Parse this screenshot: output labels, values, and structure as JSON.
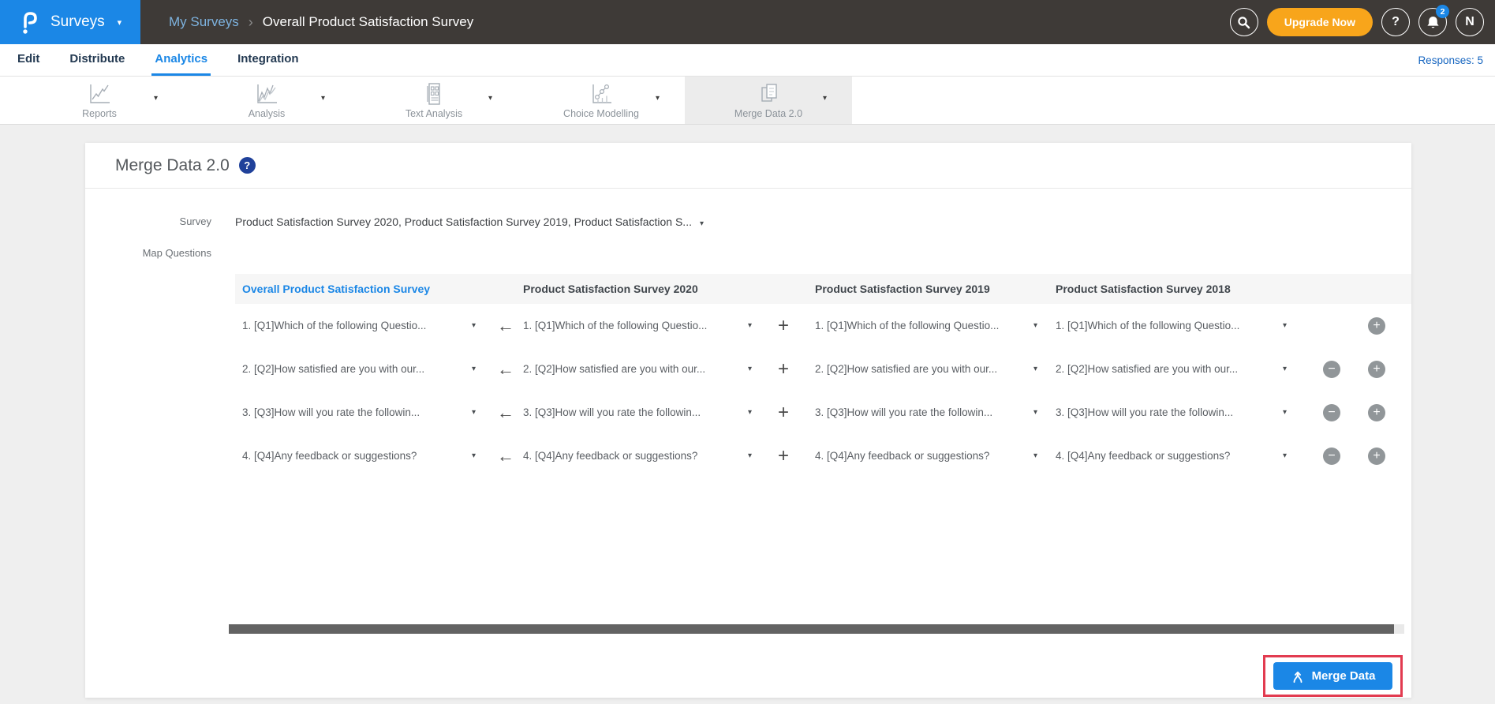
{
  "topbar": {
    "product": "Surveys",
    "breadcrumb": {
      "parent": "My Surveys",
      "separator": "›",
      "current": "Overall Product Satisfaction Survey"
    },
    "upgrade_button": "Upgrade Now",
    "help_glyph": "?",
    "notification_badge": "2",
    "avatar_initial": "N"
  },
  "nav": {
    "tabs": [
      {
        "label": "Edit"
      },
      {
        "label": "Distribute"
      },
      {
        "label": "Analytics"
      },
      {
        "label": "Integration"
      }
    ],
    "active_tab": "Analytics",
    "responses": "Responses: 5"
  },
  "toolbar": {
    "tabs": [
      {
        "label": "Reports",
        "icon": "line-chart-icon"
      },
      {
        "label": "Analysis",
        "icon": "multi-line-chart-icon"
      },
      {
        "label": "Text Analysis",
        "icon": "text-report-icon"
      },
      {
        "label": "Choice Modelling",
        "icon": "choice-chart-icon"
      },
      {
        "label": "Merge Data 2.0",
        "icon": "merge-pages-icon"
      }
    ],
    "active": "Merge Data 2.0",
    "caret": "▾"
  },
  "panel": {
    "title": "Merge Data 2.0",
    "help_glyph": "?",
    "survey": {
      "label": "Survey",
      "value": "Product Satisfaction Survey 2020, Product Satisfaction Survey 2019, Product Satisfaction S...",
      "caret": "▾"
    },
    "map_questions_label": "Map Questions",
    "table": {
      "columns": [
        {
          "label": "Overall Product Satisfaction Survey"
        },
        {
          "label": "Product Satisfaction Survey 2020"
        },
        {
          "label": "Product Satisfaction Survey 2019"
        },
        {
          "label": "Product Satisfaction Survey 2018"
        }
      ],
      "map_arrow": "←",
      "add_symbol": "+",
      "remove_symbol": "−",
      "rows": [
        {
          "question": "1. [Q1]Which of the following Questio...",
          "removable": false
        },
        {
          "question": "2. [Q2]How satisfied are you with our...",
          "removable": true
        },
        {
          "question": "3. [Q3]How will you rate the followin...",
          "removable": true
        },
        {
          "question": "4. [Q4]Any feedback or suggestions?",
          "removable": true
        }
      ]
    },
    "merge_button": "Merge Data"
  },
  "colors": {
    "accent_blue": "#1b87e6",
    "upgrade_orange": "#f8a51b",
    "annotation_red": "#e23b50",
    "topbar_dark": "#3e3a37"
  }
}
